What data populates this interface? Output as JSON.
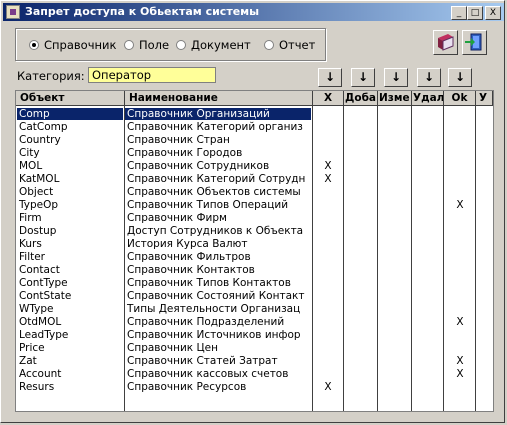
{
  "window": {
    "title": "Запрет доступа к Обьектам системы"
  },
  "titlebar_buttons": {
    "minimize": "_",
    "maximize": "□",
    "close": "X"
  },
  "scope_radio": {
    "options": [
      "Справочник",
      "Поле",
      "Документ",
      "Отчет"
    ],
    "selected": "Справочник"
  },
  "toolbar": {
    "book_icon": "book-icon",
    "exit_icon": "exit-door-icon"
  },
  "category": {
    "label": "Категория:",
    "value": "Оператор"
  },
  "arrow_buttons": [
    "↓",
    "↓",
    "↓",
    "↓",
    "↓"
  ],
  "grid": {
    "headers": [
      "Объект",
      "Наименование",
      "X",
      "Доба",
      "Изме",
      "Удал",
      "Ok",
      "У"
    ],
    "rows": [
      {
        "object": "Comp",
        "name": "Справочник Организаций",
        "x": "",
        "ok": "",
        "selected": true
      },
      {
        "object": "CatComp",
        "name": "Справочник Категорий организ",
        "x": "",
        "ok": ""
      },
      {
        "object": "Country",
        "name": "Справочник Стран",
        "x": "",
        "ok": ""
      },
      {
        "object": "City",
        "name": "Справочник Городов",
        "x": "",
        "ok": ""
      },
      {
        "object": "MOL",
        "name": "Справочник Сотрудников",
        "x": "X",
        "ok": ""
      },
      {
        "object": "KatMOL",
        "name": "Справочник Категорий Сотрудн",
        "x": "X",
        "ok": ""
      },
      {
        "object": "Object",
        "name": "Справочник Объектов системы",
        "x": "",
        "ok": ""
      },
      {
        "object": "TypeOp",
        "name": "Справочник Типов Операций",
        "x": "",
        "ok": "X"
      },
      {
        "object": "Firm",
        "name": "Справочник Фирм",
        "x": "",
        "ok": ""
      },
      {
        "object": "Dostup",
        "name": "Доступ Сотрудников к Объекта",
        "x": "",
        "ok": ""
      },
      {
        "object": "Kurs",
        "name": "История Курса Валют",
        "x": "",
        "ok": ""
      },
      {
        "object": "Filter",
        "name": "Справочник Фильтров",
        "x": "",
        "ok": ""
      },
      {
        "object": "Contact",
        "name": "Справочник Контактов",
        "x": "",
        "ok": ""
      },
      {
        "object": "ContType",
        "name": "Справочник Типов Контактов",
        "x": "",
        "ok": ""
      },
      {
        "object": "ContState",
        "name": "Справочник Состояний Контакт",
        "x": "",
        "ok": ""
      },
      {
        "object": "WType",
        "name": "Типы Деятельности Организац",
        "x": "",
        "ok": ""
      },
      {
        "object": "OtdMOL",
        "name": "Справочник Подразделений",
        "x": "",
        "ok": "X"
      },
      {
        "object": "LeadType",
        "name": "Справочник Источников инфор",
        "x": "",
        "ok": ""
      },
      {
        "object": "Price",
        "name": "Справочник Цен",
        "x": "",
        "ok": ""
      },
      {
        "object": "Zat",
        "name": "Справочник Статей Затрат",
        "x": "",
        "ok": "X"
      },
      {
        "object": "Account",
        "name": "Справочник кассовых счетов",
        "x": "",
        "ok": "X"
      },
      {
        "object": "Resurs",
        "name": "Справочник Ресурсов",
        "x": "X",
        "ok": ""
      }
    ]
  }
}
